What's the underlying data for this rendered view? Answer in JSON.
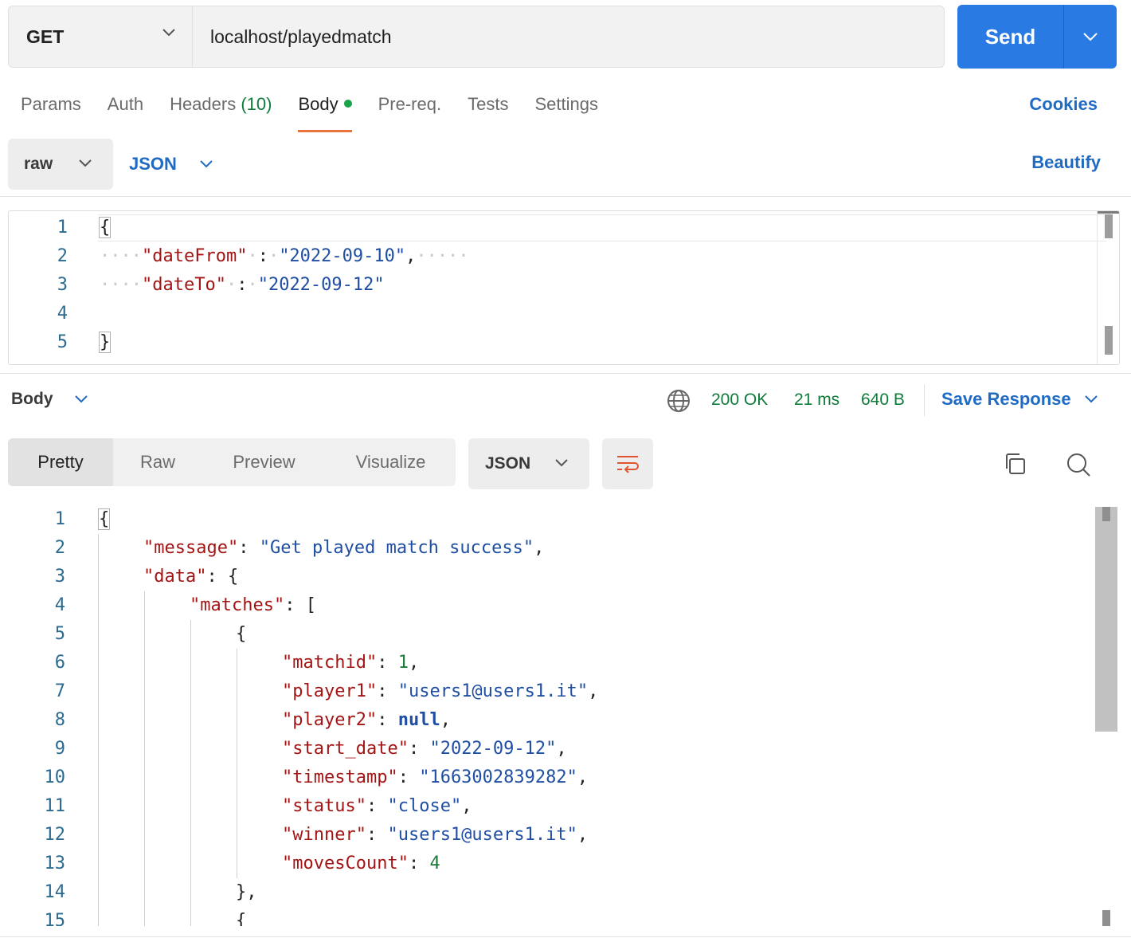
{
  "request": {
    "method": "GET",
    "url": "localhost/playedmatch",
    "send_label": "Send",
    "tabs": [
      {
        "label": "Params"
      },
      {
        "label": "Auth"
      },
      {
        "label": "Headers",
        "count": "(10)"
      },
      {
        "label": "Body"
      },
      {
        "label": "Pre-req."
      },
      {
        "label": "Tests"
      },
      {
        "label": "Settings"
      }
    ],
    "cookies_label": "Cookies",
    "body_mode": "raw",
    "body_language": "JSON",
    "beautify_label": "Beautify",
    "body_lines": [
      {
        "n": "1",
        "text": "{"
      },
      {
        "n": "2",
        "key": "\"dateFrom\"",
        "value": "\"2022-09-10\""
      },
      {
        "n": "3",
        "key": "\"dateTo\"",
        "value": "\"2022-09-12\""
      },
      {
        "n": "4",
        "text": ""
      },
      {
        "n": "5",
        "text": "}"
      }
    ]
  },
  "response": {
    "section_label": "Body",
    "status": "200 OK",
    "time": "21 ms",
    "size": "640 B",
    "save_label": "Save Response",
    "views": [
      "Pretty",
      "Raw",
      "Preview",
      "Visualize"
    ],
    "format": "JSON",
    "line_numbers": [
      "1",
      "2",
      "3",
      "4",
      "5",
      "6",
      "7",
      "8",
      "9",
      "10",
      "11",
      "12",
      "13",
      "14",
      "15"
    ],
    "json": {
      "message_key": "\"message\"",
      "message_value": "\"Get played match success\"",
      "data_key": "\"data\"",
      "matches_key": "\"matches\"",
      "fields": [
        {
          "key": "\"matchid\"",
          "value": "1",
          "type": "number",
          "comma": true
        },
        {
          "key": "\"player1\"",
          "value": "\"users1@users1.it\"",
          "type": "string",
          "comma": true
        },
        {
          "key": "\"player2\"",
          "value": "null",
          "type": "null",
          "comma": true
        },
        {
          "key": "\"start_date\"",
          "value": "\"2022-09-12\"",
          "type": "string",
          "comma": true
        },
        {
          "key": "\"timestamp\"",
          "value": "\"1663002839282\"",
          "type": "string",
          "comma": true
        },
        {
          "key": "\"status\"",
          "value": "\"close\"",
          "type": "string",
          "comma": true
        },
        {
          "key": "\"winner\"",
          "value": "\"users1@users1.it\"",
          "type": "string",
          "comma": true
        },
        {
          "key": "\"movesCount\"",
          "value": "4",
          "type": "number",
          "comma": false
        }
      ]
    }
  },
  "icons": {
    "method_dropdown": "chevron-down-icon",
    "send_dropdown": "chevron-down-icon",
    "network": "globe-icon",
    "wrap": "wrap-lines-icon",
    "copy": "copy-icon",
    "search": "search-icon"
  },
  "colors": {
    "accent": "#2a7ae4",
    "link": "#1f6bc4",
    "active_tab_underline": "#e8733b",
    "status_ok": "#0f7b3b",
    "json_key": "#a31515",
    "json_string": "#1f4ea3",
    "json_number": "#1d7a3a"
  }
}
